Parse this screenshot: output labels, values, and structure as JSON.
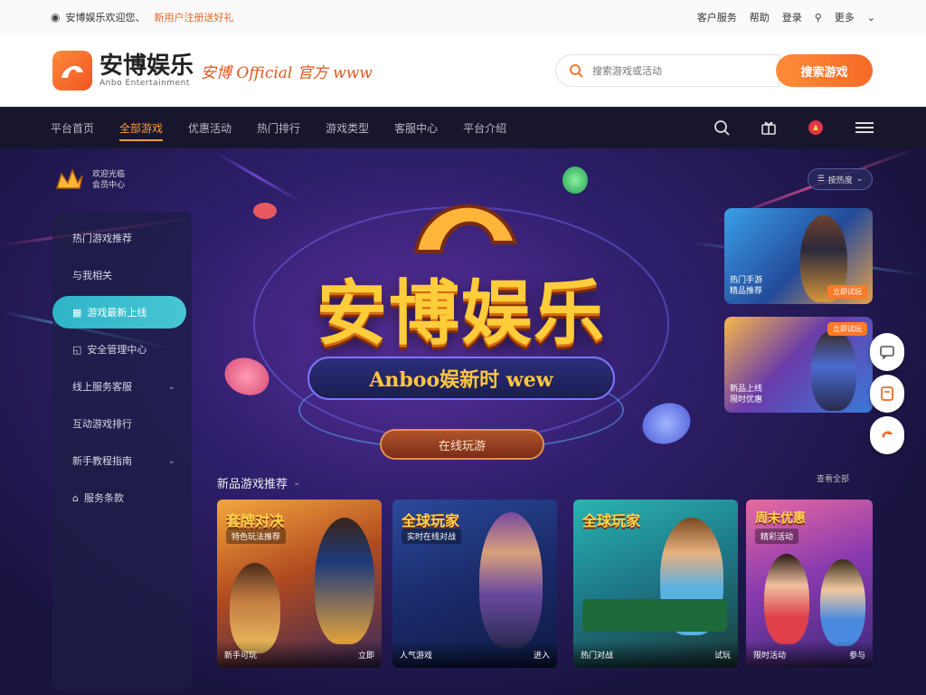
{
  "topbar": {
    "notice": "安博娱乐欢迎您、",
    "promo": "新用户注册送好礼",
    "links": [
      "客户服务",
      "帮助",
      "登录"
    ],
    "more": "更多"
  },
  "brand": {
    "name": "安博娱乐",
    "sub": "Anbo Entertainment",
    "slogan": "安博 Official 官方 www"
  },
  "search": {
    "placeholder": "搜索游戏或活动",
    "button": "搜索游戏"
  },
  "nav": {
    "items": [
      "平台首页",
      "全部游戏",
      "优惠活动",
      "热门排行",
      "游戏类型",
      "客服中心",
      "平台介绍"
    ],
    "active_index": 1
  },
  "user": {
    "line1": "欢迎光临",
    "line2": "会员中心"
  },
  "sidebar": {
    "items": [
      {
        "label": "热门游戏推荐",
        "active": false,
        "chevron": false
      },
      {
        "label": "与我相关",
        "active": false,
        "chevron": false
      },
      {
        "label": "游戏最新上线",
        "active": true,
        "chevron": false
      },
      {
        "label": "安全管理中心",
        "active": false,
        "chevron": false
      },
      {
        "label": "线上服务客服",
        "active": false,
        "chevron": true
      },
      {
        "label": "互动游戏排行",
        "active": false,
        "chevron": false
      },
      {
        "label": "新手教程指南",
        "active": false,
        "chevron": true
      },
      {
        "label": "服务条款",
        "active": false,
        "chevron": false
      }
    ]
  },
  "hero": {
    "title": "安博娱乐",
    "subtitle": "Anboo娱新时 wew",
    "cta": "在线玩游"
  },
  "filter": {
    "label": "按热度"
  },
  "side_cards": [
    {
      "caption": "热门手游\n精品推荐",
      "tag": "立即试玩",
      "tag_top": false
    },
    {
      "caption": "新品上线\n限时优惠",
      "tag": "立即试玩",
      "tag_top": true
    }
  ],
  "section": {
    "title": "新品游戏推荐",
    "more": "查看全部"
  },
  "game_cards": [
    {
      "title": "套牌对决",
      "sub": "特色玩法推荐",
      "foot_left": "新手可玩",
      "foot_right": "立即"
    },
    {
      "title": "全球玩家",
      "sub": "实时在线对战",
      "foot_left": "人气游戏",
      "foot_right": "进入"
    },
    {
      "title": "全球玩家",
      "sub": "",
      "foot_left": "热门对战",
      "foot_right": "试玩"
    },
    {
      "title": "周末优惠",
      "sub": "精彩活动",
      "foot_left": "限时活动",
      "foot_right": "参与"
    }
  ],
  "colors": {
    "accent": "#ff8a3d",
    "nav_bg": "#17162c",
    "sidebar_active": "#2fb4c8"
  }
}
